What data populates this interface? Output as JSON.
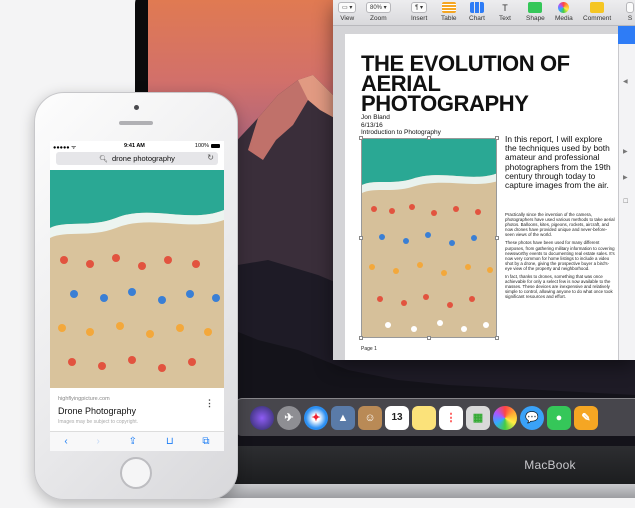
{
  "pages": {
    "toolbar": {
      "view_label": "View",
      "zoom_value": "80%",
      "zoom_label": "Zoom",
      "insert_label": "Insert",
      "table_label": "Table",
      "chart_label": "Chart",
      "text_label": "Text",
      "shape_label": "Shape",
      "media_label": "Media",
      "comment_label": "Comment",
      "partial_label": "S"
    },
    "document": {
      "title": "THE EVOLUTION OF AERIAL PHOTOGRAPHY",
      "author": "Jon Bland",
      "date": "6/13/16",
      "subtitle": "Introduction to Photography",
      "lead": "In this report, I will explore the techniques used by both amateur and professional photographers from the 19th century through today to capture images from the air.",
      "paragraphs": [
        "Practically since the invention of the camera, photographers have used various methods to take aerial photos. Balloons, kites, pigeons, rockets, aircraft, and now drones have provided unique and never-before-seen views of the world.",
        "These photos have been used for many different purposes, from gathering military information to covering newsworthy events to documenting real estate sales. It's now very common for home listings to include a video shot by a drone, giving the prospective buyer a bird's-eye view of the property and neighborhood.",
        "In fact, thanks to drones, something that was once achievable for only a select few is now available to the masses. These devices are inexpensive and relatively simple to control, allowing anyone to do what once took significant resources and effort."
      ],
      "page_number": "Page 1"
    }
  },
  "iphone": {
    "carrier": "●●●●● ᯤ",
    "time": "9:41 AM",
    "battery": "100%",
    "search_text": "drone photography",
    "result": {
      "site": "highflyingpicture.com",
      "title": "Drone Photography",
      "note": "Images may be subject to copyright."
    }
  },
  "macbook": {
    "label": "MacBook"
  },
  "dock": {
    "calendar_day": "13"
  },
  "colors": {
    "accent": "#2e7cf6",
    "sea": "#2fae9b",
    "sand": "#d8c19a"
  }
}
